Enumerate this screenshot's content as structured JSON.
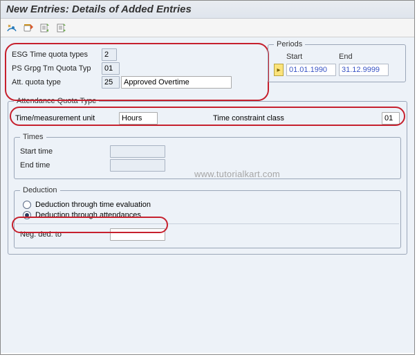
{
  "title": "New Entries: Details of Added Entries",
  "toolbar": {
    "btn1_tip": "Change/Display",
    "btn2_tip": "Delete",
    "btn3_tip": "Previous",
    "btn4_tip": "Next"
  },
  "top": {
    "esg_label": "ESG Time quota types",
    "esg_value": "2",
    "ps_label": "PS Grpg Tm Quota Typ",
    "ps_value": "01",
    "att_label": "Att. quota type",
    "att_code": "25",
    "att_text": "Approved Overtime"
  },
  "periods": {
    "title": "Periods",
    "start_label": "Start",
    "end_label": "End",
    "start": "01.01.1990",
    "end": "31.12.9999"
  },
  "watermark": "www.tutorialkart.com",
  "aqt": {
    "title": "Attendance Quota Type",
    "unit_label": "Time/measurement unit",
    "unit_value": "Hours",
    "tcc_label": "Time constraint class",
    "tcc_value": "01",
    "times": {
      "title": "Times",
      "start_label": "Start time",
      "start_value": "",
      "end_label": "End time",
      "end_value": ""
    },
    "deduction": {
      "title": "Deduction",
      "opt_eval": "Deduction through time evaluation",
      "opt_att": "Deduction through attendances",
      "selected": "att",
      "neg_label": "Neg. ded. to",
      "neg_value": ""
    }
  }
}
